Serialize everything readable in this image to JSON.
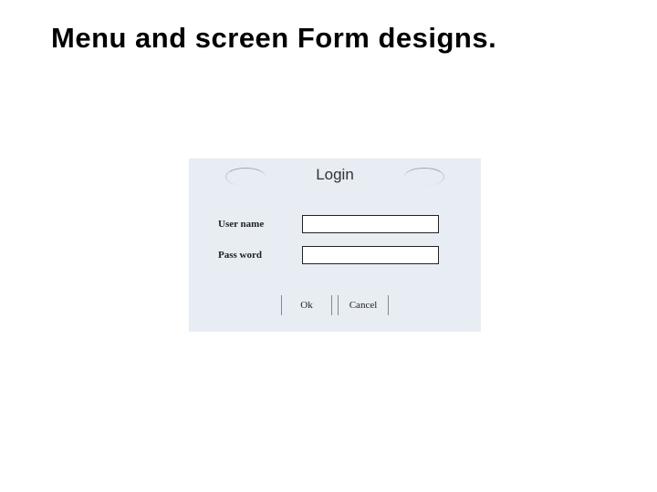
{
  "page": {
    "title": "Menu and screen Form designs."
  },
  "login": {
    "header": "Login",
    "username": {
      "label": "User name",
      "value": ""
    },
    "password": {
      "label": "Pass word",
      "value": ""
    },
    "buttons": {
      "ok": "Ok",
      "cancel": "Cancel"
    }
  }
}
